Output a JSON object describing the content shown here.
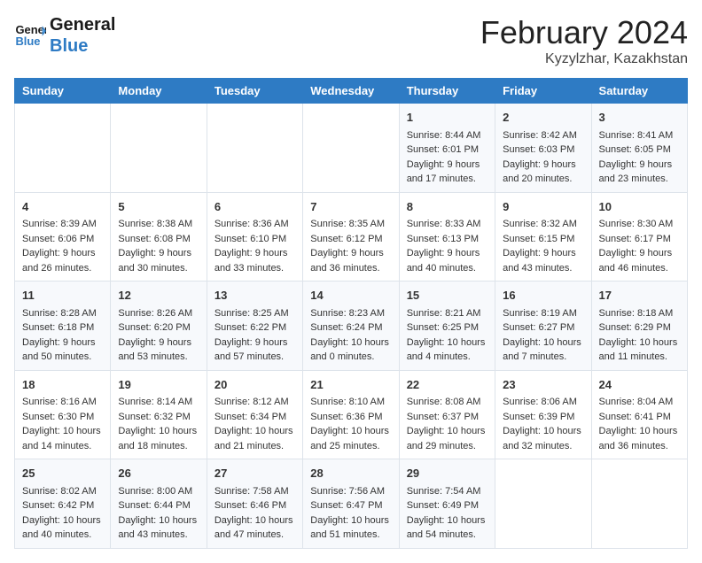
{
  "logo": {
    "text_general": "General",
    "text_blue": "Blue"
  },
  "title": "February 2024",
  "subtitle": "Kyzylzhar, Kazakhstan",
  "days_of_week": [
    "Sunday",
    "Monday",
    "Tuesday",
    "Wednesday",
    "Thursday",
    "Friday",
    "Saturday"
  ],
  "weeks": [
    [
      {
        "day": "",
        "info": ""
      },
      {
        "day": "",
        "info": ""
      },
      {
        "day": "",
        "info": ""
      },
      {
        "day": "",
        "info": ""
      },
      {
        "day": "1",
        "info": "Sunrise: 8:44 AM\nSunset: 6:01 PM\nDaylight: 9 hours and 17 minutes."
      },
      {
        "day": "2",
        "info": "Sunrise: 8:42 AM\nSunset: 6:03 PM\nDaylight: 9 hours and 20 minutes."
      },
      {
        "day": "3",
        "info": "Sunrise: 8:41 AM\nSunset: 6:05 PM\nDaylight: 9 hours and 23 minutes."
      }
    ],
    [
      {
        "day": "4",
        "info": "Sunrise: 8:39 AM\nSunset: 6:06 PM\nDaylight: 9 hours and 26 minutes."
      },
      {
        "day": "5",
        "info": "Sunrise: 8:38 AM\nSunset: 6:08 PM\nDaylight: 9 hours and 30 minutes."
      },
      {
        "day": "6",
        "info": "Sunrise: 8:36 AM\nSunset: 6:10 PM\nDaylight: 9 hours and 33 minutes."
      },
      {
        "day": "7",
        "info": "Sunrise: 8:35 AM\nSunset: 6:12 PM\nDaylight: 9 hours and 36 minutes."
      },
      {
        "day": "8",
        "info": "Sunrise: 8:33 AM\nSunset: 6:13 PM\nDaylight: 9 hours and 40 minutes."
      },
      {
        "day": "9",
        "info": "Sunrise: 8:32 AM\nSunset: 6:15 PM\nDaylight: 9 hours and 43 minutes."
      },
      {
        "day": "10",
        "info": "Sunrise: 8:30 AM\nSunset: 6:17 PM\nDaylight: 9 hours and 46 minutes."
      }
    ],
    [
      {
        "day": "11",
        "info": "Sunrise: 8:28 AM\nSunset: 6:18 PM\nDaylight: 9 hours and 50 minutes."
      },
      {
        "day": "12",
        "info": "Sunrise: 8:26 AM\nSunset: 6:20 PM\nDaylight: 9 hours and 53 minutes."
      },
      {
        "day": "13",
        "info": "Sunrise: 8:25 AM\nSunset: 6:22 PM\nDaylight: 9 hours and 57 minutes."
      },
      {
        "day": "14",
        "info": "Sunrise: 8:23 AM\nSunset: 6:24 PM\nDaylight: 10 hours and 0 minutes."
      },
      {
        "day": "15",
        "info": "Sunrise: 8:21 AM\nSunset: 6:25 PM\nDaylight: 10 hours and 4 minutes."
      },
      {
        "day": "16",
        "info": "Sunrise: 8:19 AM\nSunset: 6:27 PM\nDaylight: 10 hours and 7 minutes."
      },
      {
        "day": "17",
        "info": "Sunrise: 8:18 AM\nSunset: 6:29 PM\nDaylight: 10 hours and 11 minutes."
      }
    ],
    [
      {
        "day": "18",
        "info": "Sunrise: 8:16 AM\nSunset: 6:30 PM\nDaylight: 10 hours and 14 minutes."
      },
      {
        "day": "19",
        "info": "Sunrise: 8:14 AM\nSunset: 6:32 PM\nDaylight: 10 hours and 18 minutes."
      },
      {
        "day": "20",
        "info": "Sunrise: 8:12 AM\nSunset: 6:34 PM\nDaylight: 10 hours and 21 minutes."
      },
      {
        "day": "21",
        "info": "Sunrise: 8:10 AM\nSunset: 6:36 PM\nDaylight: 10 hours and 25 minutes."
      },
      {
        "day": "22",
        "info": "Sunrise: 8:08 AM\nSunset: 6:37 PM\nDaylight: 10 hours and 29 minutes."
      },
      {
        "day": "23",
        "info": "Sunrise: 8:06 AM\nSunset: 6:39 PM\nDaylight: 10 hours and 32 minutes."
      },
      {
        "day": "24",
        "info": "Sunrise: 8:04 AM\nSunset: 6:41 PM\nDaylight: 10 hours and 36 minutes."
      }
    ],
    [
      {
        "day": "25",
        "info": "Sunrise: 8:02 AM\nSunset: 6:42 PM\nDaylight: 10 hours and 40 minutes."
      },
      {
        "day": "26",
        "info": "Sunrise: 8:00 AM\nSunset: 6:44 PM\nDaylight: 10 hours and 43 minutes."
      },
      {
        "day": "27",
        "info": "Sunrise: 7:58 AM\nSunset: 6:46 PM\nDaylight: 10 hours and 47 minutes."
      },
      {
        "day": "28",
        "info": "Sunrise: 7:56 AM\nSunset: 6:47 PM\nDaylight: 10 hours and 51 minutes."
      },
      {
        "day": "29",
        "info": "Sunrise: 7:54 AM\nSunset: 6:49 PM\nDaylight: 10 hours and 54 minutes."
      },
      {
        "day": "",
        "info": ""
      },
      {
        "day": "",
        "info": ""
      }
    ]
  ]
}
